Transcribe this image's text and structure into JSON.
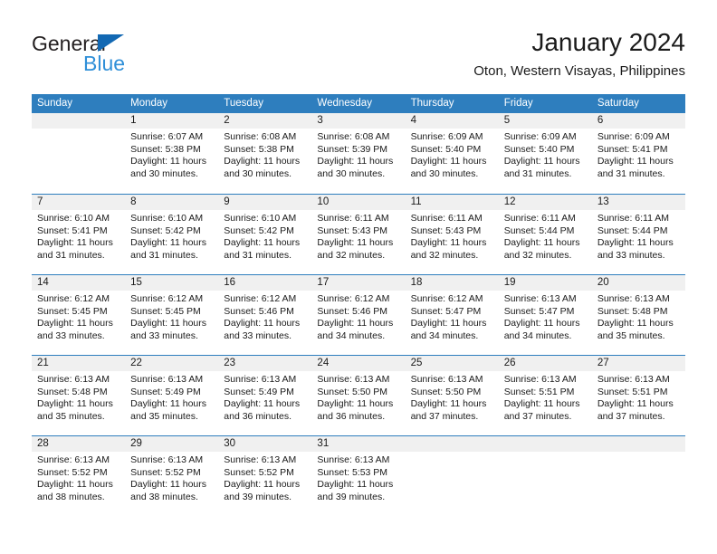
{
  "logo": {
    "word1": "General",
    "word2": "Blue",
    "triangle_color": "#1268b3",
    "word2_color": "#2f8fd8"
  },
  "header": {
    "title": "January 2024",
    "subtitle": "Oton, Western Visayas, Philippines"
  },
  "theme": {
    "header_blue": "#2e7ebe",
    "daynum_band": "#f0f0f0",
    "text": "#1a1a1a"
  },
  "calendar": {
    "weekday_headers": [
      "Sunday",
      "Monday",
      "Tuesday",
      "Wednesday",
      "Thursday",
      "Friday",
      "Saturday"
    ],
    "weeks": [
      [
        {
          "day": "",
          "lines": []
        },
        {
          "day": "1",
          "lines": [
            "Sunrise: 6:07 AM",
            "Sunset: 5:38 PM",
            "Daylight: 11 hours",
            "and 30 minutes."
          ]
        },
        {
          "day": "2",
          "lines": [
            "Sunrise: 6:08 AM",
            "Sunset: 5:38 PM",
            "Daylight: 11 hours",
            "and 30 minutes."
          ]
        },
        {
          "day": "3",
          "lines": [
            "Sunrise: 6:08 AM",
            "Sunset: 5:39 PM",
            "Daylight: 11 hours",
            "and 30 minutes."
          ]
        },
        {
          "day": "4",
          "lines": [
            "Sunrise: 6:09 AM",
            "Sunset: 5:40 PM",
            "Daylight: 11 hours",
            "and 30 minutes."
          ]
        },
        {
          "day": "5",
          "lines": [
            "Sunrise: 6:09 AM",
            "Sunset: 5:40 PM",
            "Daylight: 11 hours",
            "and 31 minutes."
          ]
        },
        {
          "day": "6",
          "lines": [
            "Sunrise: 6:09 AM",
            "Sunset: 5:41 PM",
            "Daylight: 11 hours",
            "and 31 minutes."
          ]
        }
      ],
      [
        {
          "day": "7",
          "lines": [
            "Sunrise: 6:10 AM",
            "Sunset: 5:41 PM",
            "Daylight: 11 hours",
            "and 31 minutes."
          ]
        },
        {
          "day": "8",
          "lines": [
            "Sunrise: 6:10 AM",
            "Sunset: 5:42 PM",
            "Daylight: 11 hours",
            "and 31 minutes."
          ]
        },
        {
          "day": "9",
          "lines": [
            "Sunrise: 6:10 AM",
            "Sunset: 5:42 PM",
            "Daylight: 11 hours",
            "and 31 minutes."
          ]
        },
        {
          "day": "10",
          "lines": [
            "Sunrise: 6:11 AM",
            "Sunset: 5:43 PM",
            "Daylight: 11 hours",
            "and 32 minutes."
          ]
        },
        {
          "day": "11",
          "lines": [
            "Sunrise: 6:11 AM",
            "Sunset: 5:43 PM",
            "Daylight: 11 hours",
            "and 32 minutes."
          ]
        },
        {
          "day": "12",
          "lines": [
            "Sunrise: 6:11 AM",
            "Sunset: 5:44 PM",
            "Daylight: 11 hours",
            "and 32 minutes."
          ]
        },
        {
          "day": "13",
          "lines": [
            "Sunrise: 6:11 AM",
            "Sunset: 5:44 PM",
            "Daylight: 11 hours",
            "and 33 minutes."
          ]
        }
      ],
      [
        {
          "day": "14",
          "lines": [
            "Sunrise: 6:12 AM",
            "Sunset: 5:45 PM",
            "Daylight: 11 hours",
            "and 33 minutes."
          ]
        },
        {
          "day": "15",
          "lines": [
            "Sunrise: 6:12 AM",
            "Sunset: 5:45 PM",
            "Daylight: 11 hours",
            "and 33 minutes."
          ]
        },
        {
          "day": "16",
          "lines": [
            "Sunrise: 6:12 AM",
            "Sunset: 5:46 PM",
            "Daylight: 11 hours",
            "and 33 minutes."
          ]
        },
        {
          "day": "17",
          "lines": [
            "Sunrise: 6:12 AM",
            "Sunset: 5:46 PM",
            "Daylight: 11 hours",
            "and 34 minutes."
          ]
        },
        {
          "day": "18",
          "lines": [
            "Sunrise: 6:12 AM",
            "Sunset: 5:47 PM",
            "Daylight: 11 hours",
            "and 34 minutes."
          ]
        },
        {
          "day": "19",
          "lines": [
            "Sunrise: 6:13 AM",
            "Sunset: 5:47 PM",
            "Daylight: 11 hours",
            "and 34 minutes."
          ]
        },
        {
          "day": "20",
          "lines": [
            "Sunrise: 6:13 AM",
            "Sunset: 5:48 PM",
            "Daylight: 11 hours",
            "and 35 minutes."
          ]
        }
      ],
      [
        {
          "day": "21",
          "lines": [
            "Sunrise: 6:13 AM",
            "Sunset: 5:48 PM",
            "Daylight: 11 hours",
            "and 35 minutes."
          ]
        },
        {
          "day": "22",
          "lines": [
            "Sunrise: 6:13 AM",
            "Sunset: 5:49 PM",
            "Daylight: 11 hours",
            "and 35 minutes."
          ]
        },
        {
          "day": "23",
          "lines": [
            "Sunrise: 6:13 AM",
            "Sunset: 5:49 PM",
            "Daylight: 11 hours",
            "and 36 minutes."
          ]
        },
        {
          "day": "24",
          "lines": [
            "Sunrise: 6:13 AM",
            "Sunset: 5:50 PM",
            "Daylight: 11 hours",
            "and 36 minutes."
          ]
        },
        {
          "day": "25",
          "lines": [
            "Sunrise: 6:13 AM",
            "Sunset: 5:50 PM",
            "Daylight: 11 hours",
            "and 37 minutes."
          ]
        },
        {
          "day": "26",
          "lines": [
            "Sunrise: 6:13 AM",
            "Sunset: 5:51 PM",
            "Daylight: 11 hours",
            "and 37 minutes."
          ]
        },
        {
          "day": "27",
          "lines": [
            "Sunrise: 6:13 AM",
            "Sunset: 5:51 PM",
            "Daylight: 11 hours",
            "and 37 minutes."
          ]
        }
      ],
      [
        {
          "day": "28",
          "lines": [
            "Sunrise: 6:13 AM",
            "Sunset: 5:52 PM",
            "Daylight: 11 hours",
            "and 38 minutes."
          ]
        },
        {
          "day": "29",
          "lines": [
            "Sunrise: 6:13 AM",
            "Sunset: 5:52 PM",
            "Daylight: 11 hours",
            "and 38 minutes."
          ]
        },
        {
          "day": "30",
          "lines": [
            "Sunrise: 6:13 AM",
            "Sunset: 5:52 PM",
            "Daylight: 11 hours",
            "and 39 minutes."
          ]
        },
        {
          "day": "31",
          "lines": [
            "Sunrise: 6:13 AM",
            "Sunset: 5:53 PM",
            "Daylight: 11 hours",
            "and 39 minutes."
          ]
        },
        {
          "day": "",
          "lines": []
        },
        {
          "day": "",
          "lines": []
        },
        {
          "day": "",
          "lines": []
        }
      ]
    ]
  }
}
